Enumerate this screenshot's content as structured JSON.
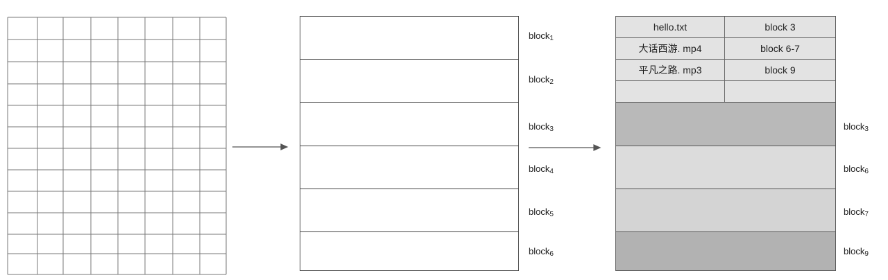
{
  "middle_blocks": [
    {
      "text": "block",
      "sub": "1"
    },
    {
      "text": "block",
      "sub": "2"
    },
    {
      "text": "block",
      "sub": "3"
    },
    {
      "text": "block",
      "sub": "4"
    },
    {
      "text": "block",
      "sub": "5"
    },
    {
      "text": "block",
      "sub": "6"
    }
  ],
  "file_table": [
    {
      "name": "hello.txt",
      "blocks": "block 3"
    },
    {
      "name": "大话西游. mp4",
      "blocks": "block 6-7"
    },
    {
      "name": "平凡之路. mp3",
      "blocks": "block 9"
    },
    {
      "name": "",
      "blocks": ""
    }
  ],
  "data_blocks": [
    {
      "text": "block",
      "sub": "3",
      "color": "#b9b9b9"
    },
    {
      "text": "block",
      "sub": "6",
      "color": "#dcdcdc"
    },
    {
      "text": "block",
      "sub": "7",
      "color": "#d4d4d4"
    },
    {
      "text": "block",
      "sub": "9",
      "color": "#b2b2b2"
    }
  ],
  "colors": {
    "line": "#555555",
    "grid": "#777777",
    "table_bg": "#e3e3e3"
  }
}
